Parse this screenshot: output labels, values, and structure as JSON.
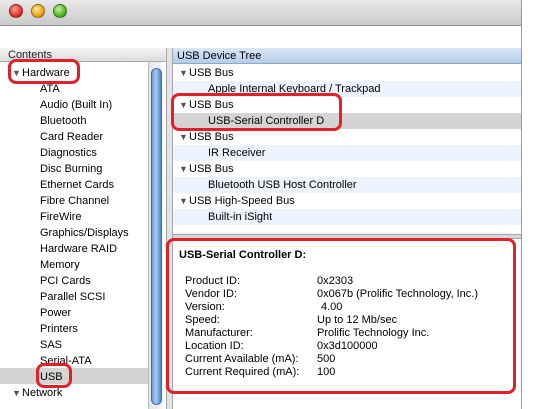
{
  "sidebar": {
    "header": "Contents",
    "groups": {
      "hardware": "Hardware",
      "network": "Network"
    },
    "items": [
      "ATA",
      "Audio (Built In)",
      "Bluetooth",
      "Card Reader",
      "Diagnostics",
      "Disc Burning",
      "Ethernet Cards",
      "Fibre Channel",
      "FireWire",
      "Graphics/Displays",
      "Hardware RAID",
      "Memory",
      "PCI Cards",
      "Parallel SCSI",
      "Power",
      "Printers",
      "SAS",
      "Serial-ATA",
      "USB"
    ],
    "selected": "USB"
  },
  "tree": {
    "header": "USB Device Tree",
    "rows": [
      {
        "label": "USB Bus",
        "type": "bus"
      },
      {
        "label": "Apple Internal Keyboard / Trackpad",
        "type": "device"
      },
      {
        "label": "USB Bus",
        "type": "bus"
      },
      {
        "label": "USB-Serial Controller D",
        "type": "device",
        "selected": true
      },
      {
        "label": "USB Bus",
        "type": "bus"
      },
      {
        "label": "IR Receiver",
        "type": "device"
      },
      {
        "label": "USB Bus",
        "type": "bus"
      },
      {
        "label": "Bluetooth USB Host Controller",
        "type": "device"
      },
      {
        "label": "USB High-Speed Bus",
        "type": "bus"
      },
      {
        "label": "Built-in iSight",
        "type": "device"
      }
    ]
  },
  "detail": {
    "title": "USB-Serial Controller D:",
    "fields": [
      {
        "label": "Product ID:",
        "value": "0x2303"
      },
      {
        "label": "Vendor ID:",
        "value": "0x067b  (Prolific Technology, Inc.)"
      },
      {
        "label": "Version:",
        "value": "4.00"
      },
      {
        "label": "Speed:",
        "value": "Up to 12 Mb/sec"
      },
      {
        "label": "Manufacturer:",
        "value": "Prolific Technology Inc."
      },
      {
        "label": "Location ID:",
        "value": "0x3d100000"
      },
      {
        "label": "Current Available (mA):",
        "value": "500"
      },
      {
        "label": "Current Required (mA):",
        "value": "100"
      }
    ]
  },
  "colors": {
    "annotation": "#e2202a",
    "tree_header": "#b4cde9",
    "selection": "#d4d4d4"
  }
}
